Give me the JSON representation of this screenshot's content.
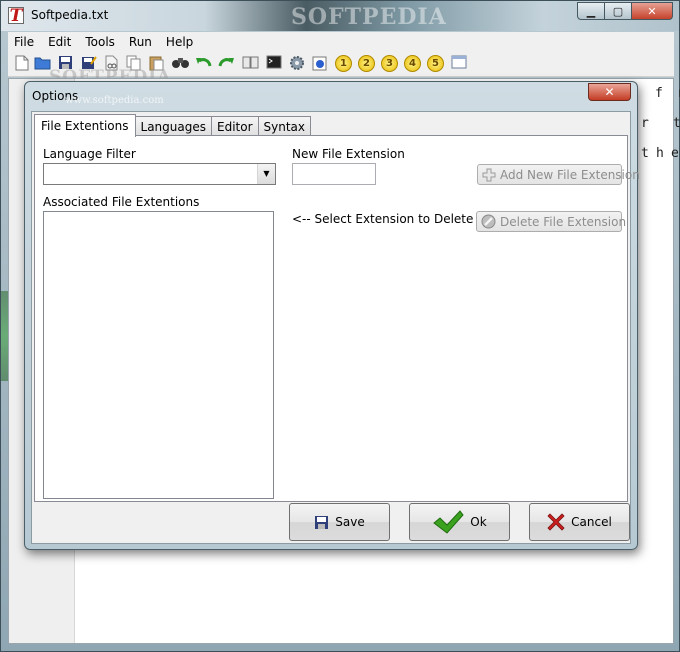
{
  "window": {
    "title": "Softpedia.txt",
    "watermark": "SOFTPEDIA",
    "controls": {
      "minimize": "▁",
      "maximize": "▢",
      "close": "✕"
    }
  },
  "menu": [
    "File",
    "Edit",
    "Tools",
    "Run",
    "Help"
  ],
  "toolbar": {
    "icons": [
      "new-file-icon",
      "open-folder-icon",
      "save-icon",
      "save-as-icon",
      "cut-icon",
      "copy-icon",
      "paste-icon",
      "find-binoculars-icon",
      "undo-icon",
      "redo-icon",
      "book-icon",
      "terminal-icon",
      "gear-icon",
      "help-icon",
      "bookmark-1-icon",
      "bookmark-2-icon",
      "bookmark-3-icon",
      "bookmark-4-icon",
      "bookmark-5-icon",
      "window-icon"
    ],
    "numbers": [
      "1",
      "2",
      "3",
      "4",
      "5"
    ],
    "watermark": "SOFTPEDIA"
  },
  "editor": {
    "right_letters": [
      "f",
      "r",
      "r",
      "t",
      "t",
      "h",
      "e"
    ]
  },
  "dialog": {
    "title": "Options",
    "title_watermark": "www.softpedia.com",
    "close": "✕",
    "tabs": [
      {
        "label": "File Extentions",
        "active": true
      },
      {
        "label": "Languages",
        "active": false
      },
      {
        "label": "Editor",
        "active": false
      },
      {
        "label": "Syntax",
        "active": false
      }
    ],
    "language_filter_label": "Language Filter",
    "language_filter_value": "",
    "associated_label": "Associated File Extentions",
    "new_ext_label": "New File Extension",
    "new_ext_value": "",
    "add_button": "Add New File Extension",
    "select_hint": "<-- Select Extension to Delete -->",
    "delete_button": "Delete File Extension",
    "save_button": "Save",
    "ok_button": "Ok",
    "cancel_button": "Cancel"
  },
  "colors": {
    "accent_close": "#c43c24",
    "ok_check": "#3aa21f",
    "cancel_x": "#cc1f1f"
  }
}
